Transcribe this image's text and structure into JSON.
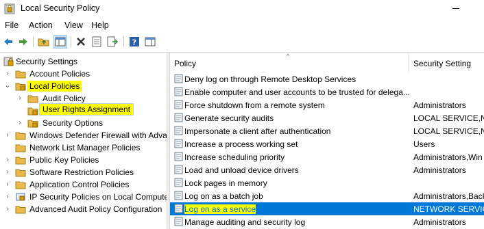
{
  "window": {
    "title": "Local Security Policy"
  },
  "menu": [
    "File",
    "Action",
    "View",
    "Help"
  ],
  "toolbar": [
    "back-icon",
    "forward-icon",
    "up-folder-icon",
    "show-hide-tree-icon",
    "delete-icon",
    "properties-icon",
    "export-list-icon",
    "help-icon",
    "mmc-pane-icon"
  ],
  "tree": {
    "root": "Security Settings",
    "items": [
      {
        "label": "Account Policies"
      },
      {
        "label": "Local Policies"
      },
      {
        "label": "Audit Policy"
      },
      {
        "label": "User Rights Assignment"
      },
      {
        "label": "Security Options"
      },
      {
        "label": "Windows Defender Firewall with Adva"
      },
      {
        "label": "Network List Manager Policies"
      },
      {
        "label": "Public Key Policies"
      },
      {
        "label": "Software Restriction Policies"
      },
      {
        "label": "Application Control Policies"
      },
      {
        "label": "IP Security Policies on Local Compute"
      },
      {
        "label": "Advanced Audit Policy Configuration"
      }
    ]
  },
  "list": {
    "headers": {
      "policy": "Policy",
      "setting": "Security Setting"
    },
    "rows": [
      {
        "policy": "Deny log on through Remote Desktop Services",
        "setting": ""
      },
      {
        "policy": "Enable computer and user accounts to be trusted for delega...",
        "setting": ""
      },
      {
        "policy": "Force shutdown from a remote system",
        "setting": "Administrators"
      },
      {
        "policy": "Generate security audits",
        "setting": "LOCAL SERVICE,NET"
      },
      {
        "policy": "Impersonate a client after authentication",
        "setting": "LOCAL SERVICE,NET"
      },
      {
        "policy": "Increase a process working set",
        "setting": "Users"
      },
      {
        "policy": "Increase scheduling priority",
        "setting": "Administrators,Win"
      },
      {
        "policy": "Load and unload device drivers",
        "setting": "Administrators"
      },
      {
        "policy": "Lock pages in memory",
        "setting": ""
      },
      {
        "policy": "Log on as a batch job",
        "setting": "Administrators,Back"
      },
      {
        "policy": "Log on as a service",
        "setting": "NETWORK SERVICE,"
      },
      {
        "policy": "Manage auditing and security log",
        "setting": "Administrators"
      }
    ]
  },
  "colors": {
    "highlight": "#ffff00",
    "selection": "#0078d7"
  }
}
